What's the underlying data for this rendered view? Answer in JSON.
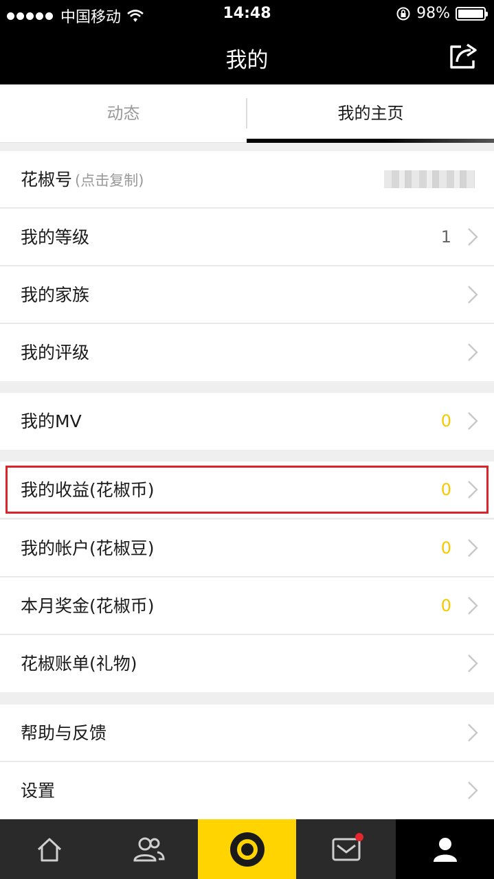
{
  "status_bar": {
    "carrier": "中国移动",
    "time": "14:48",
    "battery": "98%"
  },
  "navbar": {
    "title": "我的",
    "share_icon": "share-icon"
  },
  "tabs": [
    {
      "label": "动态",
      "active": false
    },
    {
      "label": "我的主页",
      "active": true
    }
  ],
  "rows": {
    "huajiao_id": {
      "label": "花椒号",
      "hint": "(点击复制)"
    },
    "level": {
      "label": "我的等级",
      "value": "1"
    },
    "family": {
      "label": "我的家族"
    },
    "rating": {
      "label": "我的评级"
    },
    "mv": {
      "label": "我的MV",
      "value": "0"
    },
    "earnings": {
      "label": "我的收益(花椒币)",
      "value": "0"
    },
    "account": {
      "label": "我的帐户(花椒豆)",
      "value": "0"
    },
    "bonus": {
      "label": "本月奖金(花椒币)",
      "value": "0"
    },
    "bill": {
      "label": "花椒账单(礼物)"
    },
    "help": {
      "label": "帮助与反馈"
    },
    "settings": {
      "label": "设置"
    }
  },
  "bottom_nav": {
    "items": [
      "home-icon",
      "friends-icon",
      "live-camera-icon",
      "messages-icon",
      "profile-icon"
    ],
    "accent_color": "#ffd400",
    "unread_dot_color": "#e5262c"
  },
  "colors": {
    "value_yellow": "#f6c800",
    "highlight_red": "#d9252a"
  }
}
